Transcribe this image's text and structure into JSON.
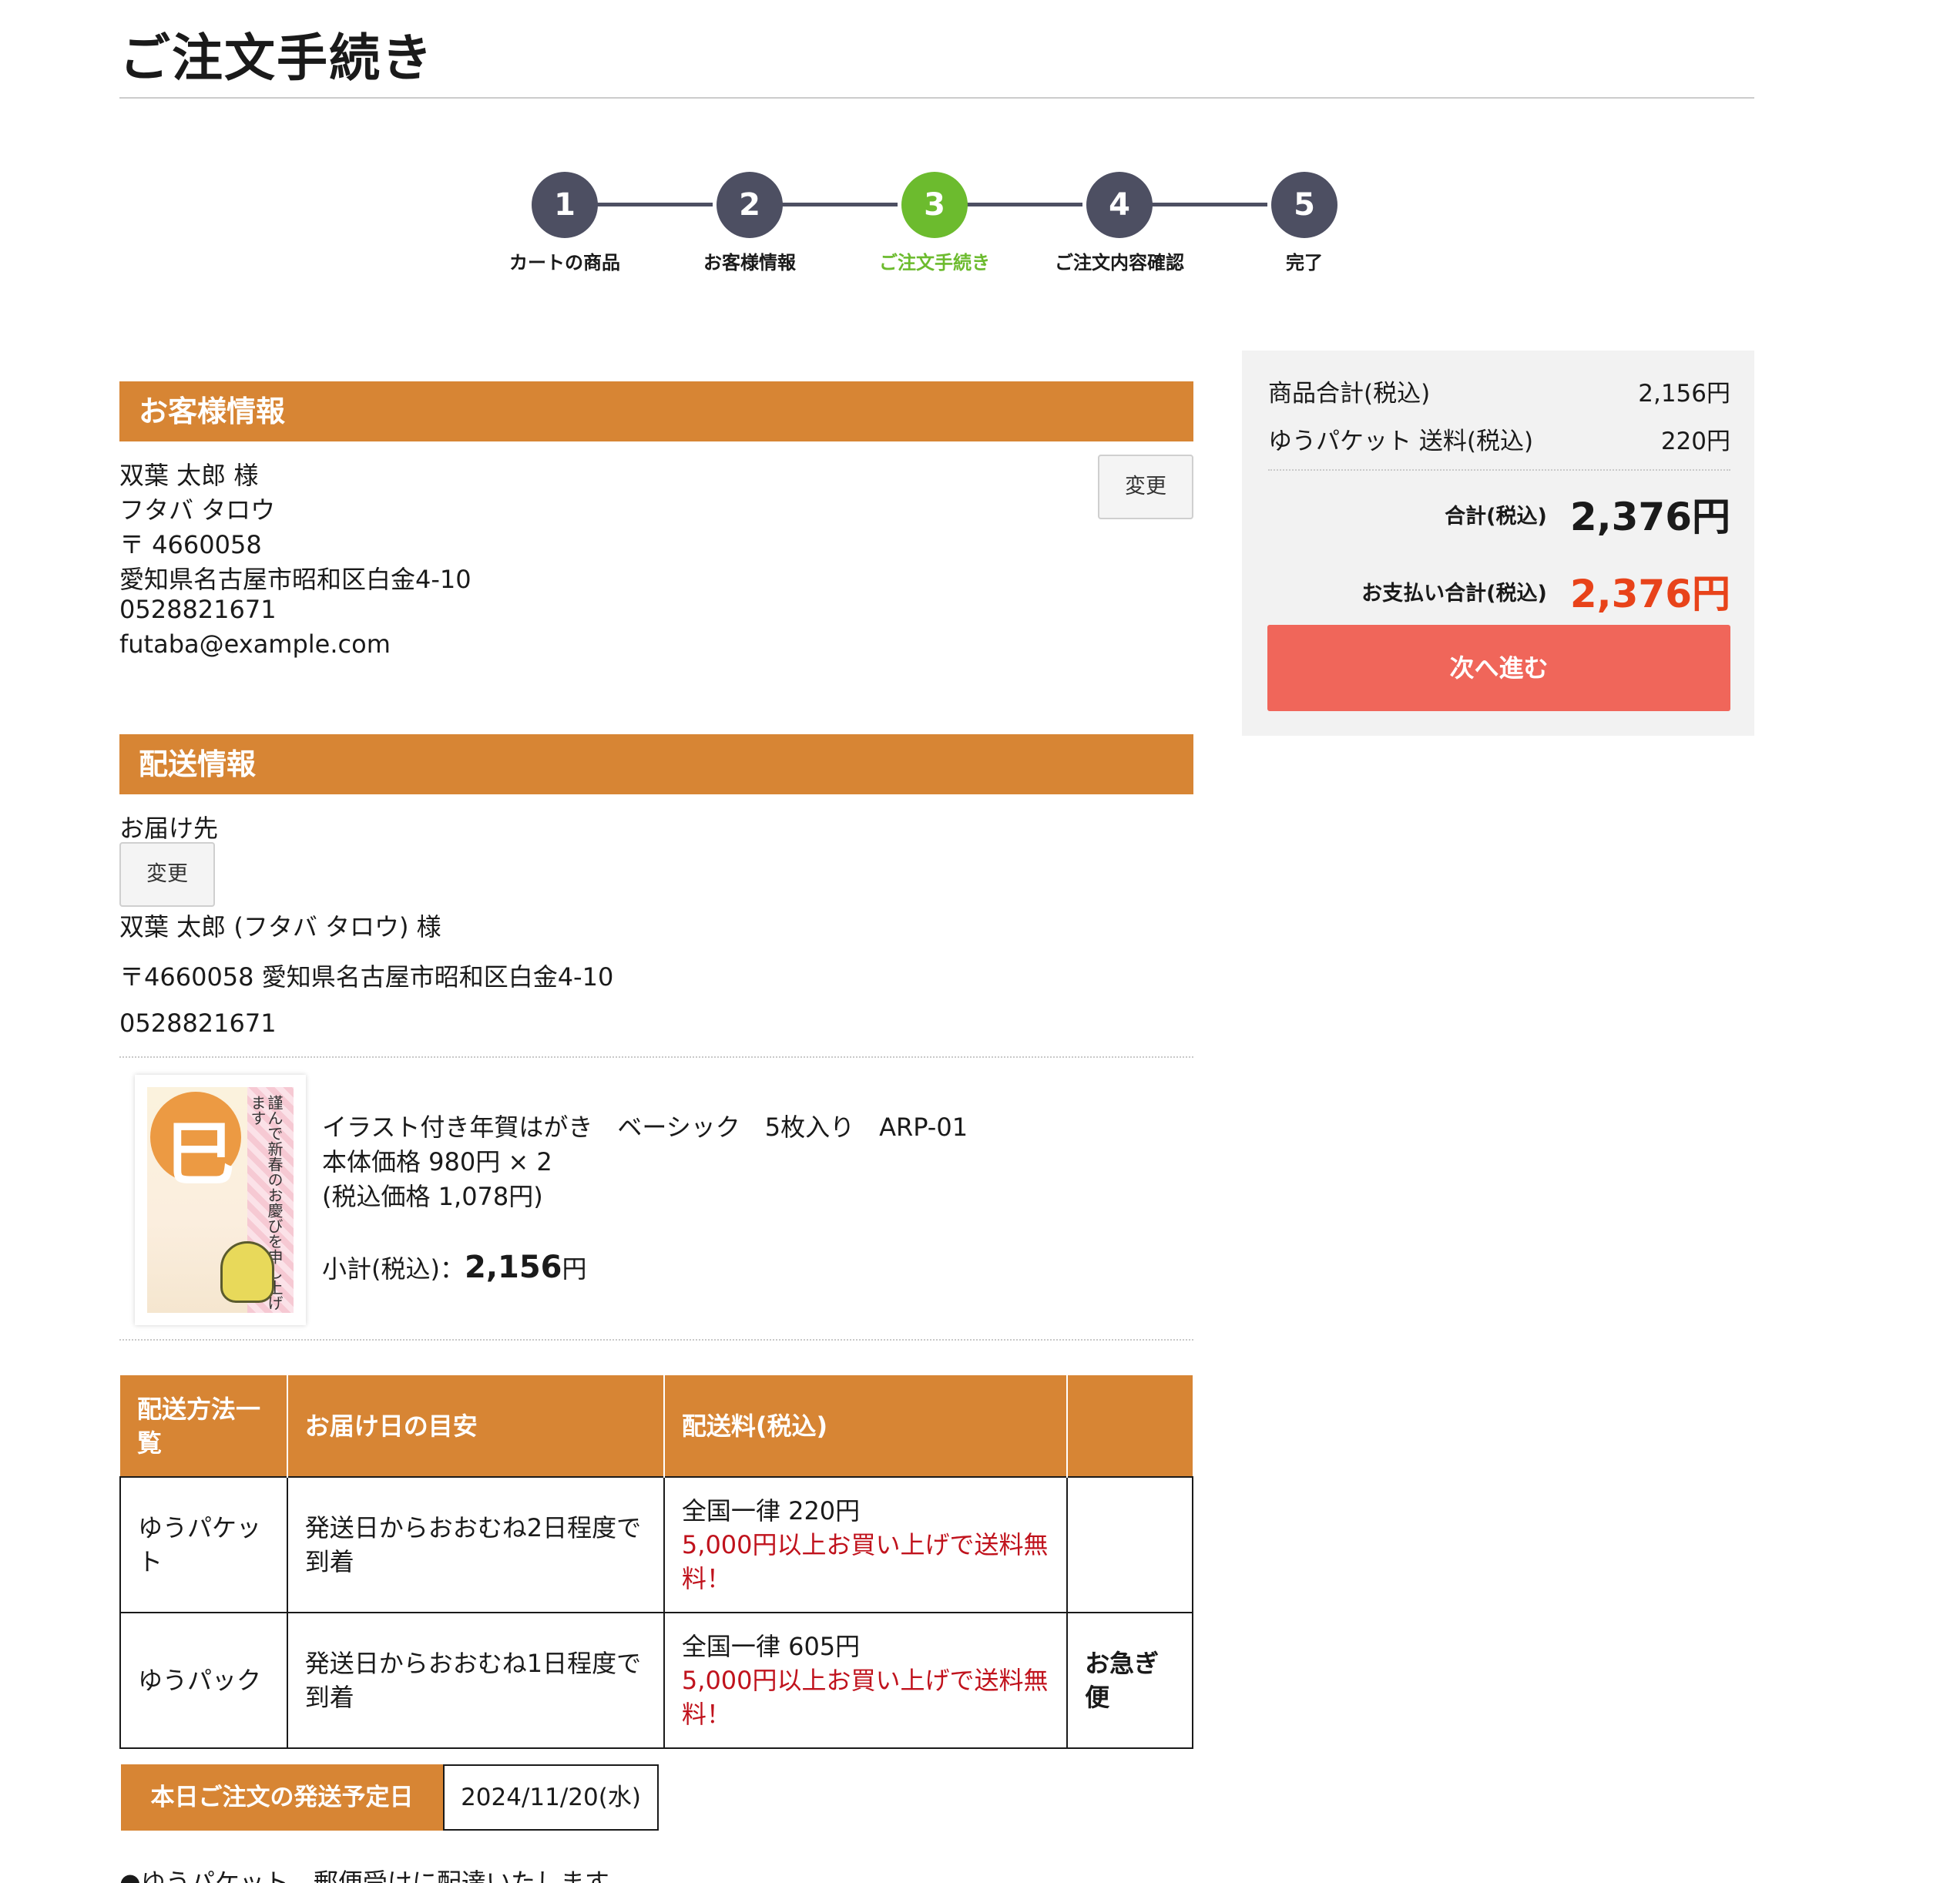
{
  "page": {
    "title": "ご注文手続き"
  },
  "stepper": {
    "steps": [
      {
        "number": "1",
        "label": "カートの商品"
      },
      {
        "number": "2",
        "label": "お客様情報"
      },
      {
        "number": "3",
        "label": "ご注文手続き"
      },
      {
        "number": "4",
        "label": "ご注文内容確認"
      },
      {
        "number": "5",
        "label": "完了"
      }
    ],
    "active_step": 3,
    "active_color": "#6cbb2e",
    "inactive_color": "#4d4f62"
  },
  "customer": {
    "header": "お客様情報",
    "change_label": "変更",
    "name": "双葉 太郎 様",
    "kana": "フタバ タロウ",
    "postal": "〒 4660058",
    "address": "愛知県名古屋市昭和区白金4-10",
    "phone": "0528821671",
    "email": "futaba@example.com"
  },
  "delivery": {
    "header": "配送情報",
    "destination_label": "お届け先",
    "change_label": "変更",
    "recipient": "双葉 太郎 (フタバ タロウ) 様",
    "address": "〒4660058 愛知県名古屋市昭和区白金4-10",
    "phone": "0528821671"
  },
  "product": {
    "image_icon": "nengajo-card-thumbnail",
    "name": "イラスト付き年賀はがき　ベーシック　5枚入り　ARP-01",
    "price": "本体価格 980円 × 2",
    "tax_price": "(税込価格 1,078円)",
    "subtotal_label": "小計(税込)：",
    "subtotal_amount": "2,156",
    "subtotal_unit": "円"
  },
  "shipping_table": {
    "headers": [
      "配送方法一覧",
      "お届け日の目安",
      "配送料(税込)",
      ""
    ],
    "rows": [
      {
        "method": "ゆうパケット",
        "eta": "発送日からおおむね2日程度で到着",
        "fee": "全国一律 220円",
        "free_note": "5,000円以上お買い上げで送料無料！",
        "tag": ""
      },
      {
        "method": "ゆうパック",
        "eta": "発送日からおおむね1日程度で到着",
        "fee": "全国一律 605円",
        "free_note": "5,000円以上お買い上げで送料無料！",
        "tag": "お急ぎ便"
      }
    ]
  },
  "ship_date": {
    "label": "本日ご注文の発送予定日",
    "value": "2024/11/20(水)"
  },
  "note": "●ゆうパケット　郵便受けに配達いたします。",
  "summary": {
    "items_label": "商品合計(税込)",
    "items_value": "2,156円",
    "shipping_label": "ゆうパケット 送料(税込)",
    "shipping_value": "220円",
    "total_label": "合計(税込)",
    "total_value": "2,376円",
    "payment_label": "お支払い合計(税込)",
    "payment_value": "2,376円",
    "next_label": "次へ進む"
  },
  "colors": {
    "section_header": "#d78534",
    "next_button": "#f0665a",
    "payment_total": "#e8431a",
    "free_shipping_note": "#c0121c"
  }
}
